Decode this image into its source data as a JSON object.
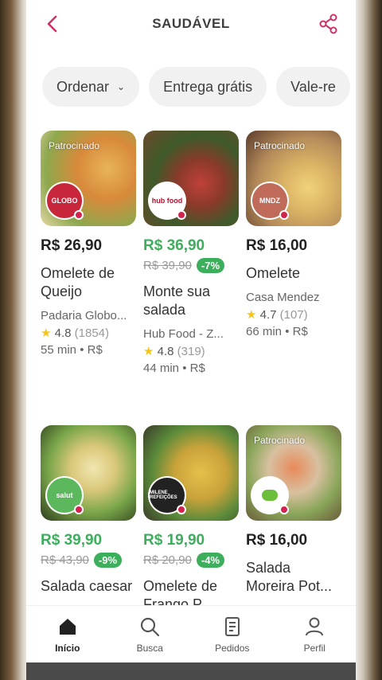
{
  "header": {
    "title": "SAUDÁVEL"
  },
  "chips": [
    {
      "label": "Ordenar",
      "has_chevron": true
    },
    {
      "label": "Entrega grátis"
    },
    {
      "label": "Vale-re"
    }
  ],
  "products": [
    {
      "badge": "Patrocinado",
      "logo_text": "GLOBO",
      "price": "R$ 26,90",
      "name": "Omelete de Queijo",
      "store": "Padaria Globo...",
      "rating": "4.8",
      "reviews": "(1854)",
      "meta": "55 min • R$"
    },
    {
      "badge": "",
      "logo_text": "hub food",
      "price": "R$ 36,90",
      "old_price": "R$ 39,90",
      "discount": "-7%",
      "name": "Monte sua salada",
      "store": "Hub Food - Z...",
      "rating": "4.8",
      "reviews": "(319)",
      "meta": "44 min • R$"
    },
    {
      "badge": "Patrocinado",
      "logo_text": "MNDZ",
      "price": "R$ 16,00",
      "name": "Omelete",
      "store": "Casa Mendez",
      "rating": "4.7",
      "reviews": "(107)",
      "meta": "66 min • R$"
    },
    {
      "badge": "",
      "logo_text": "salut",
      "price": "R$ 39,90",
      "old_price": "R$ 43,90",
      "discount": "-9%",
      "name": "Salada caesar"
    },
    {
      "badge": "",
      "logo_text": "MILENE REFEIÇÕES",
      "price": "R$ 19,90",
      "old_price": "R$ 20,90",
      "discount": "-4%",
      "name": "Omelete de Frango P..."
    },
    {
      "badge": "Patrocinado",
      "logo_text": "",
      "price": "R$ 16,00",
      "name": "Salada Moreira Pot..."
    }
  ],
  "nav": [
    {
      "label": "Início",
      "icon": "home-icon"
    },
    {
      "label": "Busca",
      "icon": "search-icon"
    },
    {
      "label": "Pedidos",
      "icon": "orders-icon"
    },
    {
      "label": "Perfil",
      "icon": "profile-icon"
    }
  ],
  "colors": {
    "brand": "#ea1d2c",
    "accent_icon": "#c8336a",
    "discount": "#3dae5c"
  }
}
